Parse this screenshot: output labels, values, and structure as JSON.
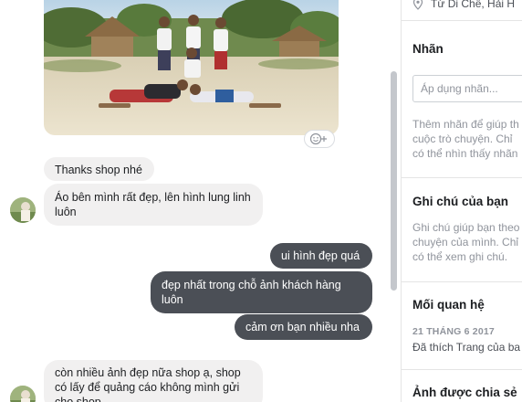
{
  "chat": {
    "image_alt": "beach group photo",
    "messages": [
      {
        "id": "m1",
        "side": "in",
        "text": "Thanks shop nhé"
      },
      {
        "id": "m2",
        "side": "in",
        "lines": [
          "Áo bên mình rất đẹp, lên hình lung linh",
          "luôn"
        ]
      },
      {
        "id": "m3",
        "side": "out",
        "text": "ui hình đẹp quá"
      },
      {
        "id": "m4",
        "side": "out",
        "lines": [
          "đẹp nhất trong chỗ ảnh khách hàng",
          "luôn"
        ]
      },
      {
        "id": "m5",
        "side": "out",
        "text": "cảm ơn bạn nhiều nha"
      },
      {
        "id": "m6",
        "side": "in",
        "lines": [
          "còn nhiều ảnh đẹp nữa shop ạ, shop",
          "có lấy để quảng cáo không mình gửi",
          "cho shop"
        ]
      }
    ]
  },
  "panel": {
    "location": "Từ Di Chế, Hải H",
    "labels": {
      "title": "Nhãn",
      "placeholder": "Áp dụng nhãn...",
      "help": [
        "Thêm nhãn để giúp th",
        "cuộc trò chuyện. Chỉ",
        "có thể nhìn thấy nhãn"
      ]
    },
    "notes": {
      "title": "Ghi chú của bạn",
      "help": [
        "Ghi chú giúp bạn theo",
        "chuyện của mình. Chỉ",
        "có thể xem ghi chú."
      ]
    },
    "relationship": {
      "title": "Mối quan hệ",
      "date": "21 THÁNG 6 2017",
      "text": "Đã thích Trang của ba"
    },
    "shared": {
      "title": "Ảnh được chia sẻ"
    }
  },
  "colors": {
    "outgoing": "#4b4f56",
    "incoming": "#f1f0f0",
    "muted": "#90949c"
  }
}
